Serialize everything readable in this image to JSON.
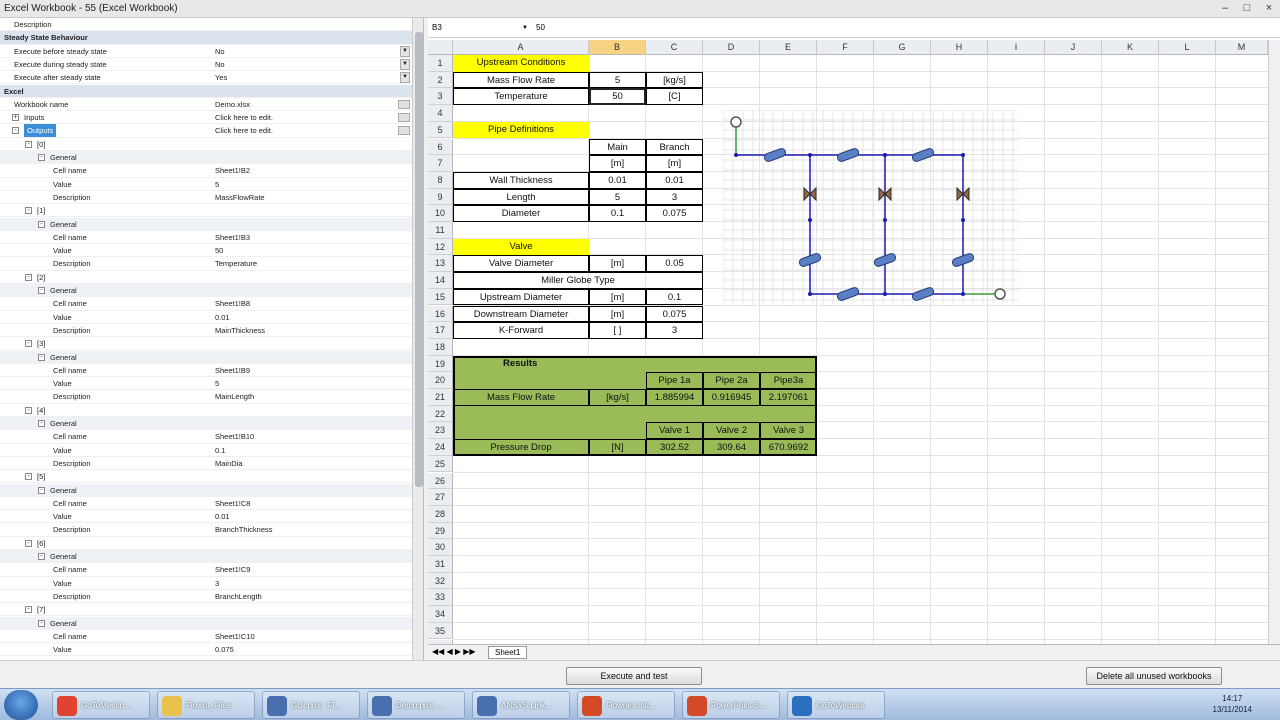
{
  "window": {
    "title": "Excel Workbook - 55 (Excel Workbook)"
  },
  "propgrid": {
    "rows": [
      {
        "name": "Description",
        "value": "",
        "kind": "prop",
        "indent": 0
      },
      {
        "name": "Steady State Behaviour",
        "value": "",
        "kind": "cat",
        "indent": 0
      },
      {
        "name": "Execute before steady state",
        "value": "No",
        "kind": "prop",
        "indent": 0,
        "dd": true
      },
      {
        "name": "Execute during steady state",
        "value": "No",
        "kind": "prop",
        "indent": 0,
        "dd": true
      },
      {
        "name": "Execute after steady state",
        "value": "Yes",
        "kind": "prop",
        "indent": 0,
        "dd": true
      },
      {
        "name": "Excel",
        "value": "",
        "kind": "cat",
        "indent": 0
      },
      {
        "name": "Workbook name",
        "value": "Demo.xlsx",
        "kind": "prop",
        "indent": 0,
        "edit": true
      },
      {
        "name": "Inputs",
        "value": "Click here to edit.",
        "kind": "prop",
        "indent": 0,
        "toggle": "+",
        "edit": true
      },
      {
        "name": "Outputs",
        "value": "Click here to edit.",
        "kind": "prop",
        "indent": 0,
        "toggle": "-",
        "edit": true,
        "selected": true
      },
      {
        "name": "[0]",
        "value": "",
        "kind": "prop",
        "indent": 1,
        "toggle": "-"
      },
      {
        "name": "General",
        "value": "",
        "kind": "sub",
        "indent": 2,
        "toggle": "-"
      },
      {
        "name": "Cell name",
        "value": "Sheet1!B2",
        "kind": "prop",
        "indent": 3
      },
      {
        "name": "Value",
        "value": "5",
        "kind": "prop",
        "indent": 3
      },
      {
        "name": "Description",
        "value": "MassFlowRate",
        "kind": "prop",
        "indent": 3
      },
      {
        "name": "[1]",
        "value": "",
        "kind": "prop",
        "indent": 1,
        "toggle": "-"
      },
      {
        "name": "General",
        "value": "",
        "kind": "sub",
        "indent": 2,
        "toggle": "-"
      },
      {
        "name": "Cell name",
        "value": "Sheet1!B3",
        "kind": "prop",
        "indent": 3
      },
      {
        "name": "Value",
        "value": "50",
        "kind": "prop",
        "indent": 3
      },
      {
        "name": "Description",
        "value": "Temperature",
        "kind": "prop",
        "indent": 3
      },
      {
        "name": "[2]",
        "value": "",
        "kind": "prop",
        "indent": 1,
        "toggle": "-"
      },
      {
        "name": "General",
        "value": "",
        "kind": "sub",
        "indent": 2,
        "toggle": "-"
      },
      {
        "name": "Cell name",
        "value": "Sheet1!B8",
        "kind": "prop",
        "indent": 3
      },
      {
        "name": "Value",
        "value": "0.01",
        "kind": "prop",
        "indent": 3
      },
      {
        "name": "Description",
        "value": "MainThickness",
        "kind": "prop",
        "indent": 3
      },
      {
        "name": "[3]",
        "value": "",
        "kind": "prop",
        "indent": 1,
        "toggle": "-"
      },
      {
        "name": "General",
        "value": "",
        "kind": "sub",
        "indent": 2,
        "toggle": "-"
      },
      {
        "name": "Cell name",
        "value": "Sheet1!B9",
        "kind": "prop",
        "indent": 3
      },
      {
        "name": "Value",
        "value": "5",
        "kind": "prop",
        "indent": 3
      },
      {
        "name": "Description",
        "value": "MainLength",
        "kind": "prop",
        "indent": 3
      },
      {
        "name": "[4]",
        "value": "",
        "kind": "prop",
        "indent": 1,
        "toggle": "-"
      },
      {
        "name": "General",
        "value": "",
        "kind": "sub",
        "indent": 2,
        "toggle": "-"
      },
      {
        "name": "Cell name",
        "value": "Sheet1!B10",
        "kind": "prop",
        "indent": 3
      },
      {
        "name": "Value",
        "value": "0.1",
        "kind": "prop",
        "indent": 3
      },
      {
        "name": "Description",
        "value": "MainDia",
        "kind": "prop",
        "indent": 3
      },
      {
        "name": "[5]",
        "value": "",
        "kind": "prop",
        "indent": 1,
        "toggle": "-"
      },
      {
        "name": "General",
        "value": "",
        "kind": "sub",
        "indent": 2,
        "toggle": "-"
      },
      {
        "name": "Cell name",
        "value": "Sheet1!C8",
        "kind": "prop",
        "indent": 3
      },
      {
        "name": "Value",
        "value": "0.01",
        "kind": "prop",
        "indent": 3
      },
      {
        "name": "Description",
        "value": "BranchThickness",
        "kind": "prop",
        "indent": 3
      },
      {
        "name": "[6]",
        "value": "",
        "kind": "prop",
        "indent": 1,
        "toggle": "-"
      },
      {
        "name": "General",
        "value": "",
        "kind": "sub",
        "indent": 2,
        "toggle": "-"
      },
      {
        "name": "Cell name",
        "value": "Sheet1!C9",
        "kind": "prop",
        "indent": 3
      },
      {
        "name": "Value",
        "value": "3",
        "kind": "prop",
        "indent": 3
      },
      {
        "name": "Description",
        "value": "BranchLength",
        "kind": "prop",
        "indent": 3
      },
      {
        "name": "[7]",
        "value": "",
        "kind": "prop",
        "indent": 1,
        "toggle": "-"
      },
      {
        "name": "General",
        "value": "",
        "kind": "sub",
        "indent": 2,
        "toggle": "-"
      },
      {
        "name": "Cell name",
        "value": "Sheet1!C10",
        "kind": "prop",
        "indent": 3
      },
      {
        "name": "Value",
        "value": "0.075",
        "kind": "prop",
        "indent": 3
      }
    ]
  },
  "excel": {
    "name_box": "B3",
    "formula_value": "50",
    "columns": [
      "A",
      "B",
      "C",
      "D",
      "E",
      "F",
      "G",
      "H",
      "I",
      "J",
      "K",
      "L",
      "M"
    ],
    "selected_column": "B",
    "row_count": 36,
    "sheet_tab": "Sheet1",
    "cells": [
      {
        "r": 1,
        "c": "A",
        "t": "Upstream Conditions",
        "bg": "yel"
      },
      {
        "r": 2,
        "c": "A",
        "t": "Mass Flow Rate",
        "box": true
      },
      {
        "r": 2,
        "c": "B",
        "t": "5",
        "box": true
      },
      {
        "r": 2,
        "c": "C",
        "t": "[kg/s]",
        "box": true
      },
      {
        "r": 3,
        "c": "A",
        "t": "Temperature",
        "box": true
      },
      {
        "r": 3,
        "c": "B",
        "t": "50",
        "box": true
      },
      {
        "r": 3,
        "c": "C",
        "t": "[C]",
        "box": true
      },
      {
        "r": 5,
        "c": "A",
        "t": "Pipe Definitions",
        "bg": "yel"
      },
      {
        "r": 6,
        "c": "B",
        "t": "Main",
        "box": true
      },
      {
        "r": 6,
        "c": "C",
        "t": "Branch",
        "box": true
      },
      {
        "r": 7,
        "c": "B",
        "t": "[m]",
        "box": true
      },
      {
        "r": 7,
        "c": "C",
        "t": "[m]",
        "box": true
      },
      {
        "r": 8,
        "c": "A",
        "t": "Wall Thickness",
        "box": true
      },
      {
        "r": 8,
        "c": "B",
        "t": "0.01",
        "box": true
      },
      {
        "r": 8,
        "c": "C",
        "t": "0.01",
        "box": true
      },
      {
        "r": 9,
        "c": "A",
        "t": "Length",
        "box": true
      },
      {
        "r": 9,
        "c": "B",
        "t": "5",
        "box": true
      },
      {
        "r": 9,
        "c": "C",
        "t": "3",
        "box": true
      },
      {
        "r": 10,
        "c": "A",
        "t": "Diameter",
        "box": true
      },
      {
        "r": 10,
        "c": "B",
        "t": "0.1",
        "box": true
      },
      {
        "r": 10,
        "c": "C",
        "t": "0.075",
        "box": true
      },
      {
        "r": 12,
        "c": "A",
        "t": "Valve",
        "bg": "yel"
      },
      {
        "r": 13,
        "c": "A",
        "t": "Valve Diameter",
        "box": true
      },
      {
        "r": 13,
        "c": "B",
        "t": "[m]",
        "box": true
      },
      {
        "r": 13,
        "c": "C",
        "t": "0.05",
        "box": true
      },
      {
        "r": 14,
        "c": "A",
        "t": "Miller Globe Type",
        "span": 3,
        "box": true
      },
      {
        "r": 15,
        "c": "A",
        "t": "Upstream Diameter",
        "box": true
      },
      {
        "r": 15,
        "c": "B",
        "t": "[m]",
        "box": true
      },
      {
        "r": 15,
        "c": "C",
        "t": "0.1",
        "box": true
      },
      {
        "r": 16,
        "c": "A",
        "t": "Downstream Diameter",
        "box": true
      },
      {
        "r": 16,
        "c": "B",
        "t": "[m]",
        "box": true
      },
      {
        "r": 16,
        "c": "C",
        "t": "0.075",
        "box": true
      },
      {
        "r": 17,
        "c": "A",
        "t": "K-Forward",
        "box": true
      },
      {
        "r": 17,
        "c": "B",
        "t": "[ ]",
        "box": true
      },
      {
        "r": 17,
        "c": "C",
        "t": "3",
        "box": true
      },
      {
        "r": 19,
        "c": "A",
        "t": "Results",
        "bold": true
      },
      {
        "r": 20,
        "c": "C",
        "t": "Pipe 1a",
        "box": true
      },
      {
        "r": 20,
        "c": "D",
        "t": "Pipe 2a",
        "box": true
      },
      {
        "r": 20,
        "c": "E",
        "t": "Pipe3a",
        "box": true
      },
      {
        "r": 21,
        "c": "A",
        "t": "Mass Flow Rate",
        "box": true
      },
      {
        "r": 21,
        "c": "B",
        "t": "[kg/s]",
        "box": true
      },
      {
        "r": 21,
        "c": "C",
        "t": "1.885994",
        "box": true
      },
      {
        "r": 21,
        "c": "D",
        "t": "0.916945",
        "box": true
      },
      {
        "r": 21,
        "c": "E",
        "t": "2.197061",
        "box": true
      },
      {
        "r": 23,
        "c": "C",
        "t": "Valve 1",
        "box": true
      },
      {
        "r": 23,
        "c": "D",
        "t": "Valve 2",
        "box": true
      },
      {
        "r": 23,
        "c": "E",
        "t": "Valve 3",
        "box": true
      },
      {
        "r": 24,
        "c": "A",
        "t": "Pressure Drop",
        "box": true
      },
      {
        "r": 24,
        "c": "B",
        "t": "[N]",
        "box": true
      },
      {
        "r": 24,
        "c": "C",
        "t": "302.52",
        "box": true
      },
      {
        "r": 24,
        "c": "D",
        "t": "309.64",
        "box": true
      },
      {
        "r": 24,
        "c": "E",
        "t": "670.9692",
        "box": true
      }
    ]
  },
  "buttons": {
    "execute": "Execute and test",
    "delete_unused": "Delete all unused workbooks"
  },
  "taskbar": {
    "items": [
      {
        "label": "GoToMeetin...",
        "color": "#e0432f"
      },
      {
        "label": "Flownt_Files",
        "color": "#e8c24a"
      },
      {
        "label": "GUI.proj - Fl...",
        "color": "#4a6fb0"
      },
      {
        "label": "Demo.proj -...",
        "color": "#4a6fb0"
      },
      {
        "label": "ANSYS Link...",
        "color": "#4a6fb0"
      },
      {
        "label": "Flownex Intr...",
        "color": "#d24a26"
      },
      {
        "label": "PowerPoint S...",
        "color": "#d24a26"
      },
      {
        "label": "GoToWebinar",
        "color": "#2a6fc0"
      }
    ],
    "time": "14:17",
    "date": "13/11/2014"
  }
}
